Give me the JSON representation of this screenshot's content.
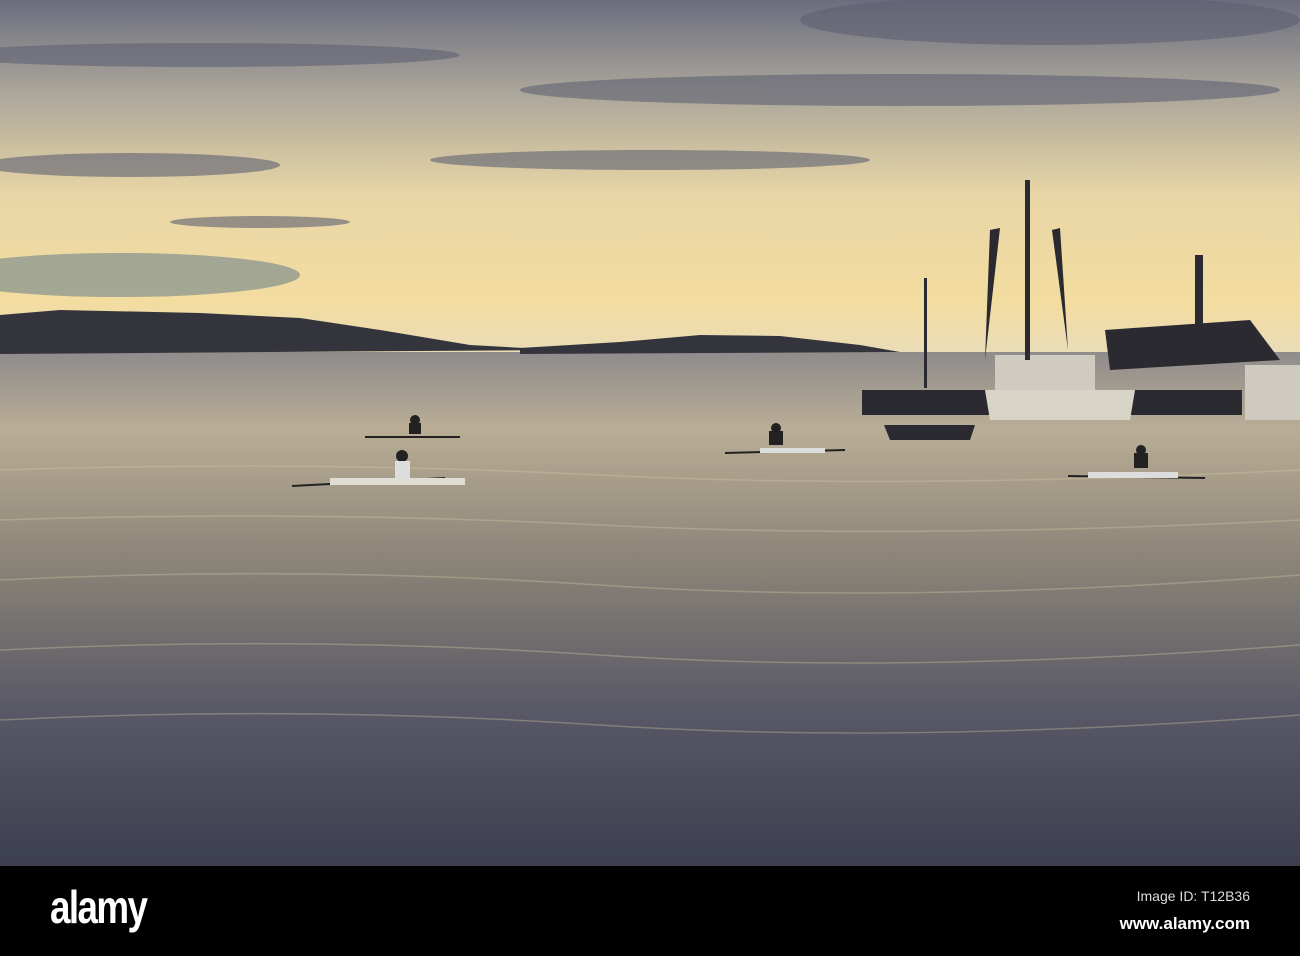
{
  "photo": {
    "subject": "rowers-at-sunset-harbour",
    "colors": {
      "sky_top": "#6b6d7e",
      "sky_glow": "#f3dca0",
      "water_top": "#b9ad95",
      "water_bottom": "#3c3f50",
      "silhouette": "#2a2a30"
    }
  },
  "watermark": {
    "brand": "alamy"
  },
  "footer": {
    "logo": "alamy",
    "image_id": "Image ID: T12B36",
    "website": "www.alamy.com"
  }
}
